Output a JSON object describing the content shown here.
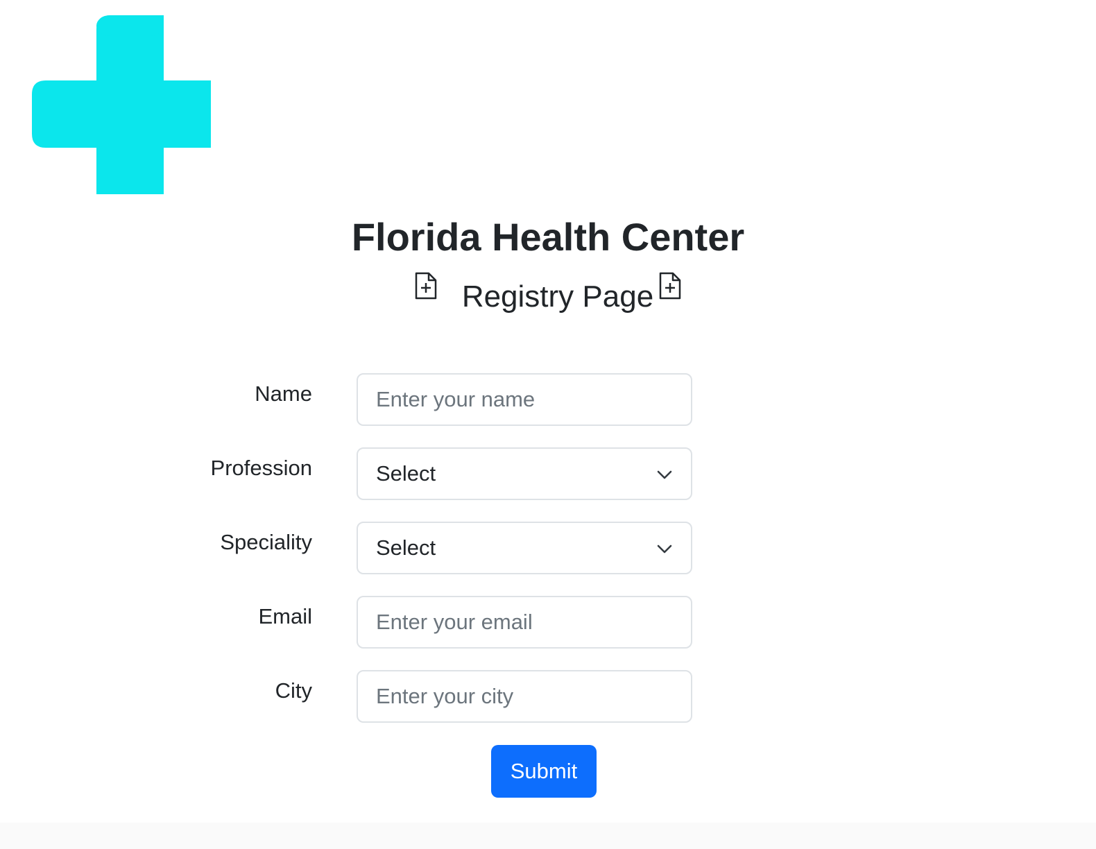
{
  "header": {
    "title": "Florida Health Center",
    "subtitle": "Registry Page",
    "logo_icon": "medical-cross-icon",
    "logo_color": "#0be6ec",
    "subtitle_icon": "file-plus-icon"
  },
  "form": {
    "fields": [
      {
        "label": "Name",
        "type": "input",
        "placeholder": "Enter your name"
      },
      {
        "label": "Profession",
        "type": "select",
        "value": "Select"
      },
      {
        "label": "Speciality",
        "type": "select",
        "value": "Select"
      },
      {
        "label": "Email",
        "type": "input",
        "placeholder": "Enter your email"
      },
      {
        "label": "City",
        "type": "input",
        "placeholder": "Enter your city"
      }
    ],
    "submit_label": "Submit",
    "submit_color": "#0d6efd"
  }
}
